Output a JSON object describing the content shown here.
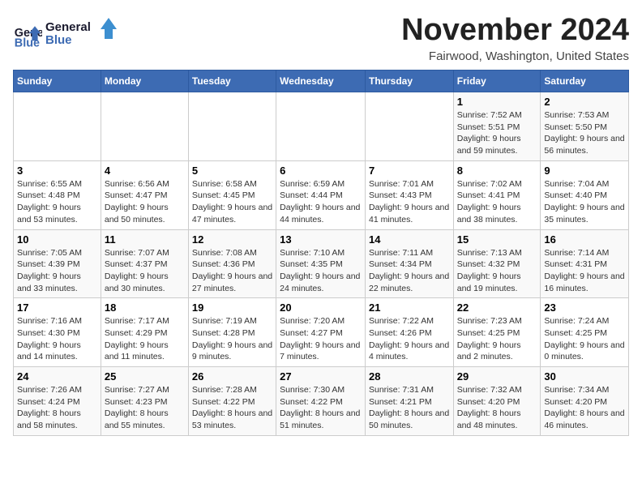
{
  "logo": {
    "line1": "General",
    "line2": "Blue"
  },
  "title": "November 2024",
  "location": "Fairwood, Washington, United States",
  "headers": [
    "Sunday",
    "Monday",
    "Tuesday",
    "Wednesday",
    "Thursday",
    "Friday",
    "Saturday"
  ],
  "weeks": [
    [
      {
        "day": "",
        "detail": ""
      },
      {
        "day": "",
        "detail": ""
      },
      {
        "day": "",
        "detail": ""
      },
      {
        "day": "",
        "detail": ""
      },
      {
        "day": "",
        "detail": ""
      },
      {
        "day": "1",
        "detail": "Sunrise: 7:52 AM\nSunset: 5:51 PM\nDaylight: 9 hours and 59 minutes."
      },
      {
        "day": "2",
        "detail": "Sunrise: 7:53 AM\nSunset: 5:50 PM\nDaylight: 9 hours and 56 minutes."
      }
    ],
    [
      {
        "day": "3",
        "detail": "Sunrise: 6:55 AM\nSunset: 4:48 PM\nDaylight: 9 hours and 53 minutes."
      },
      {
        "day": "4",
        "detail": "Sunrise: 6:56 AM\nSunset: 4:47 PM\nDaylight: 9 hours and 50 minutes."
      },
      {
        "day": "5",
        "detail": "Sunrise: 6:58 AM\nSunset: 4:45 PM\nDaylight: 9 hours and 47 minutes."
      },
      {
        "day": "6",
        "detail": "Sunrise: 6:59 AM\nSunset: 4:44 PM\nDaylight: 9 hours and 44 minutes."
      },
      {
        "day": "7",
        "detail": "Sunrise: 7:01 AM\nSunset: 4:43 PM\nDaylight: 9 hours and 41 minutes."
      },
      {
        "day": "8",
        "detail": "Sunrise: 7:02 AM\nSunset: 4:41 PM\nDaylight: 9 hours and 38 minutes."
      },
      {
        "day": "9",
        "detail": "Sunrise: 7:04 AM\nSunset: 4:40 PM\nDaylight: 9 hours and 35 minutes."
      }
    ],
    [
      {
        "day": "10",
        "detail": "Sunrise: 7:05 AM\nSunset: 4:39 PM\nDaylight: 9 hours and 33 minutes."
      },
      {
        "day": "11",
        "detail": "Sunrise: 7:07 AM\nSunset: 4:37 PM\nDaylight: 9 hours and 30 minutes."
      },
      {
        "day": "12",
        "detail": "Sunrise: 7:08 AM\nSunset: 4:36 PM\nDaylight: 9 hours and 27 minutes."
      },
      {
        "day": "13",
        "detail": "Sunrise: 7:10 AM\nSunset: 4:35 PM\nDaylight: 9 hours and 24 minutes."
      },
      {
        "day": "14",
        "detail": "Sunrise: 7:11 AM\nSunset: 4:34 PM\nDaylight: 9 hours and 22 minutes."
      },
      {
        "day": "15",
        "detail": "Sunrise: 7:13 AM\nSunset: 4:32 PM\nDaylight: 9 hours and 19 minutes."
      },
      {
        "day": "16",
        "detail": "Sunrise: 7:14 AM\nSunset: 4:31 PM\nDaylight: 9 hours and 16 minutes."
      }
    ],
    [
      {
        "day": "17",
        "detail": "Sunrise: 7:16 AM\nSunset: 4:30 PM\nDaylight: 9 hours and 14 minutes."
      },
      {
        "day": "18",
        "detail": "Sunrise: 7:17 AM\nSunset: 4:29 PM\nDaylight: 9 hours and 11 minutes."
      },
      {
        "day": "19",
        "detail": "Sunrise: 7:19 AM\nSunset: 4:28 PM\nDaylight: 9 hours and 9 minutes."
      },
      {
        "day": "20",
        "detail": "Sunrise: 7:20 AM\nSunset: 4:27 PM\nDaylight: 9 hours and 7 minutes."
      },
      {
        "day": "21",
        "detail": "Sunrise: 7:22 AM\nSunset: 4:26 PM\nDaylight: 9 hours and 4 minutes."
      },
      {
        "day": "22",
        "detail": "Sunrise: 7:23 AM\nSunset: 4:25 PM\nDaylight: 9 hours and 2 minutes."
      },
      {
        "day": "23",
        "detail": "Sunrise: 7:24 AM\nSunset: 4:25 PM\nDaylight: 9 hours and 0 minutes."
      }
    ],
    [
      {
        "day": "24",
        "detail": "Sunrise: 7:26 AM\nSunset: 4:24 PM\nDaylight: 8 hours and 58 minutes."
      },
      {
        "day": "25",
        "detail": "Sunrise: 7:27 AM\nSunset: 4:23 PM\nDaylight: 8 hours and 55 minutes."
      },
      {
        "day": "26",
        "detail": "Sunrise: 7:28 AM\nSunset: 4:22 PM\nDaylight: 8 hours and 53 minutes."
      },
      {
        "day": "27",
        "detail": "Sunrise: 7:30 AM\nSunset: 4:22 PM\nDaylight: 8 hours and 51 minutes."
      },
      {
        "day": "28",
        "detail": "Sunrise: 7:31 AM\nSunset: 4:21 PM\nDaylight: 8 hours and 50 minutes."
      },
      {
        "day": "29",
        "detail": "Sunrise: 7:32 AM\nSunset: 4:20 PM\nDaylight: 8 hours and 48 minutes."
      },
      {
        "day": "30",
        "detail": "Sunrise: 7:34 AM\nSunset: 4:20 PM\nDaylight: 8 hours and 46 minutes."
      }
    ]
  ]
}
